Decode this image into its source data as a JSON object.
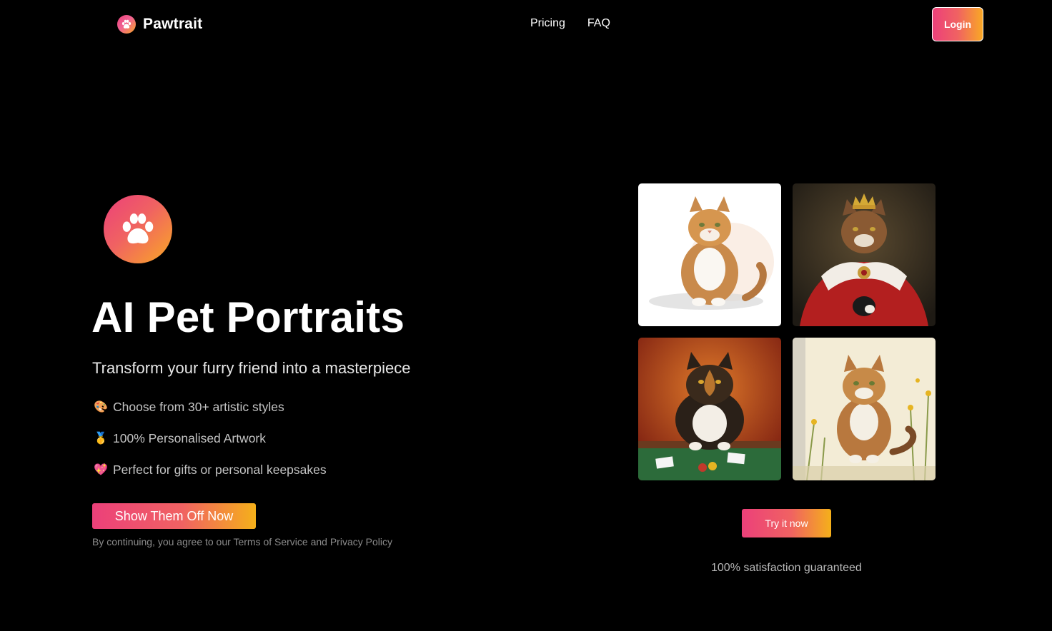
{
  "header": {
    "brand_name": "Pawtrait",
    "nav": [
      {
        "label": "Pricing"
      },
      {
        "label": "FAQ"
      }
    ],
    "login_label": "Login"
  },
  "hero": {
    "title": "AI Pet Portraits",
    "subtitle": "Transform your furry friend into a masterpiece",
    "features": [
      {
        "emoji": "🎨",
        "text": "Choose from 30+ artistic styles"
      },
      {
        "emoji": "🥇",
        "text": "100% Personalised Artwork"
      },
      {
        "emoji": "💖",
        "text": "Perfect for gifts or personal keepsakes"
      }
    ],
    "cta_label": "Show Them Off Now",
    "legal": {
      "prefix": "By continuing, you agree to our ",
      "terms": "Terms of Service",
      "middle": " and ",
      "privacy": "Privacy Policy"
    }
  },
  "gallery": {
    "images": [
      {
        "icon": "cat-watercolor-portrait"
      },
      {
        "icon": "cat-royal-portrait"
      },
      {
        "icon": "cat-poker-portrait"
      },
      {
        "icon": "cat-garden-portrait"
      }
    ]
  },
  "try_label": "Try it now",
  "guarantee": "100% satisfaction guaranteed",
  "colors": {
    "background": "#000000",
    "accent_start": "#ec407a",
    "accent_end": "#f9a825"
  }
}
